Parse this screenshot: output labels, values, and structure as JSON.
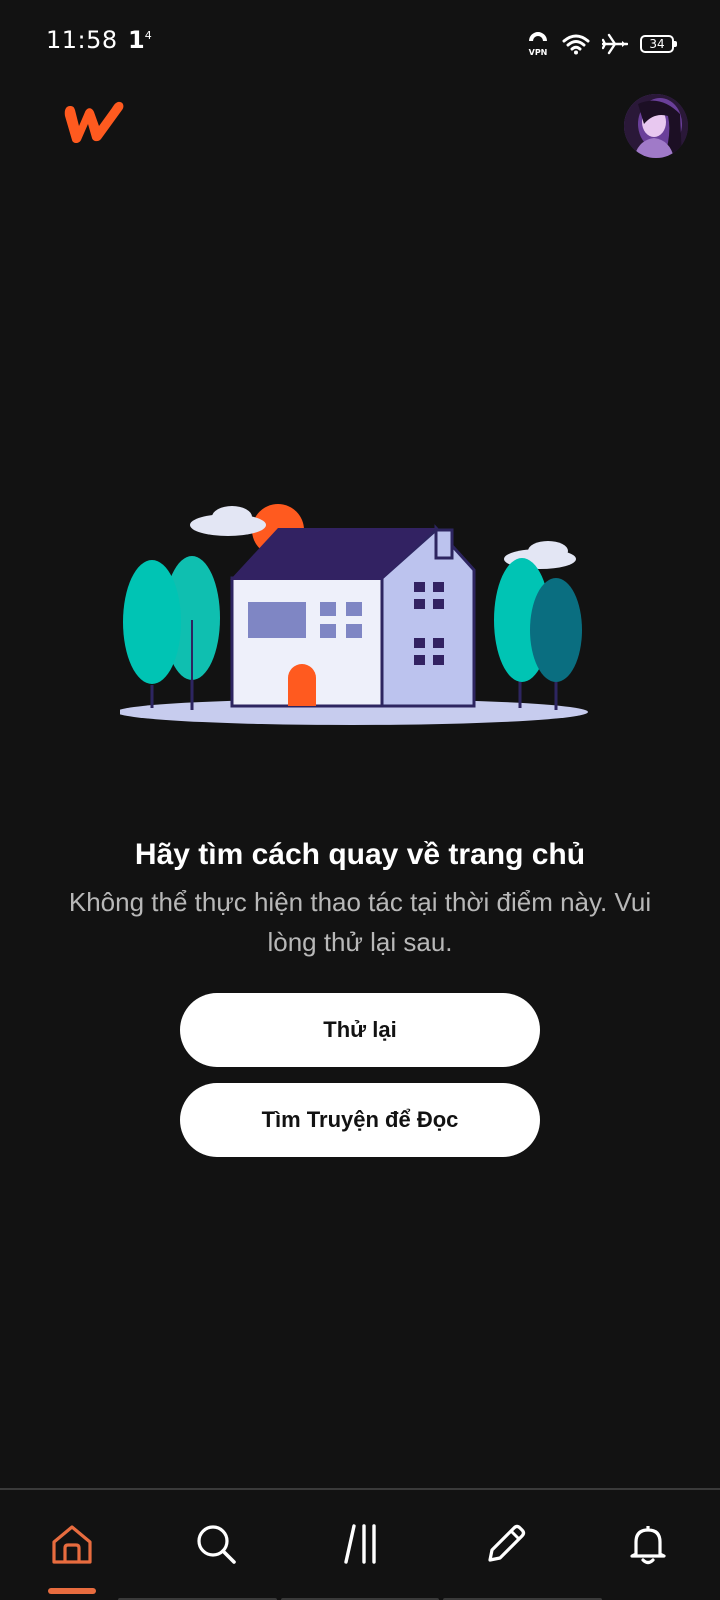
{
  "status_bar": {
    "time": "11:58",
    "indicator": "1",
    "indicator_sup": "4",
    "battery": "34",
    "icons": [
      "vpn-icon",
      "wifi-icon",
      "airplane-icon",
      "battery-icon"
    ]
  },
  "header": {
    "logo": "wattpad-logo",
    "avatar": "profile-avatar"
  },
  "message": {
    "title": "Hãy tìm cách quay về trang chủ",
    "body": "Không thể thực hiện thao tác tại thời điểm này. Vui lòng thử lại sau."
  },
  "buttons": {
    "retry": "Thử lại",
    "discover": "Tìm Truyện để Đọc"
  },
  "bottom_nav": {
    "active": "home",
    "items": [
      {
        "id": "home",
        "icon": "home-icon"
      },
      {
        "id": "search",
        "icon": "search-icon"
      },
      {
        "id": "library",
        "icon": "library-icon"
      },
      {
        "id": "write",
        "icon": "pencil-icon"
      },
      {
        "id": "notifications",
        "icon": "bell-icon"
      }
    ]
  },
  "colors": {
    "background": "#121212",
    "brand_orange": "#FF5A1F",
    "active_tab": "#E86C3F",
    "button_bg": "#FFFFFF",
    "subtext": "#B8B8B8"
  }
}
